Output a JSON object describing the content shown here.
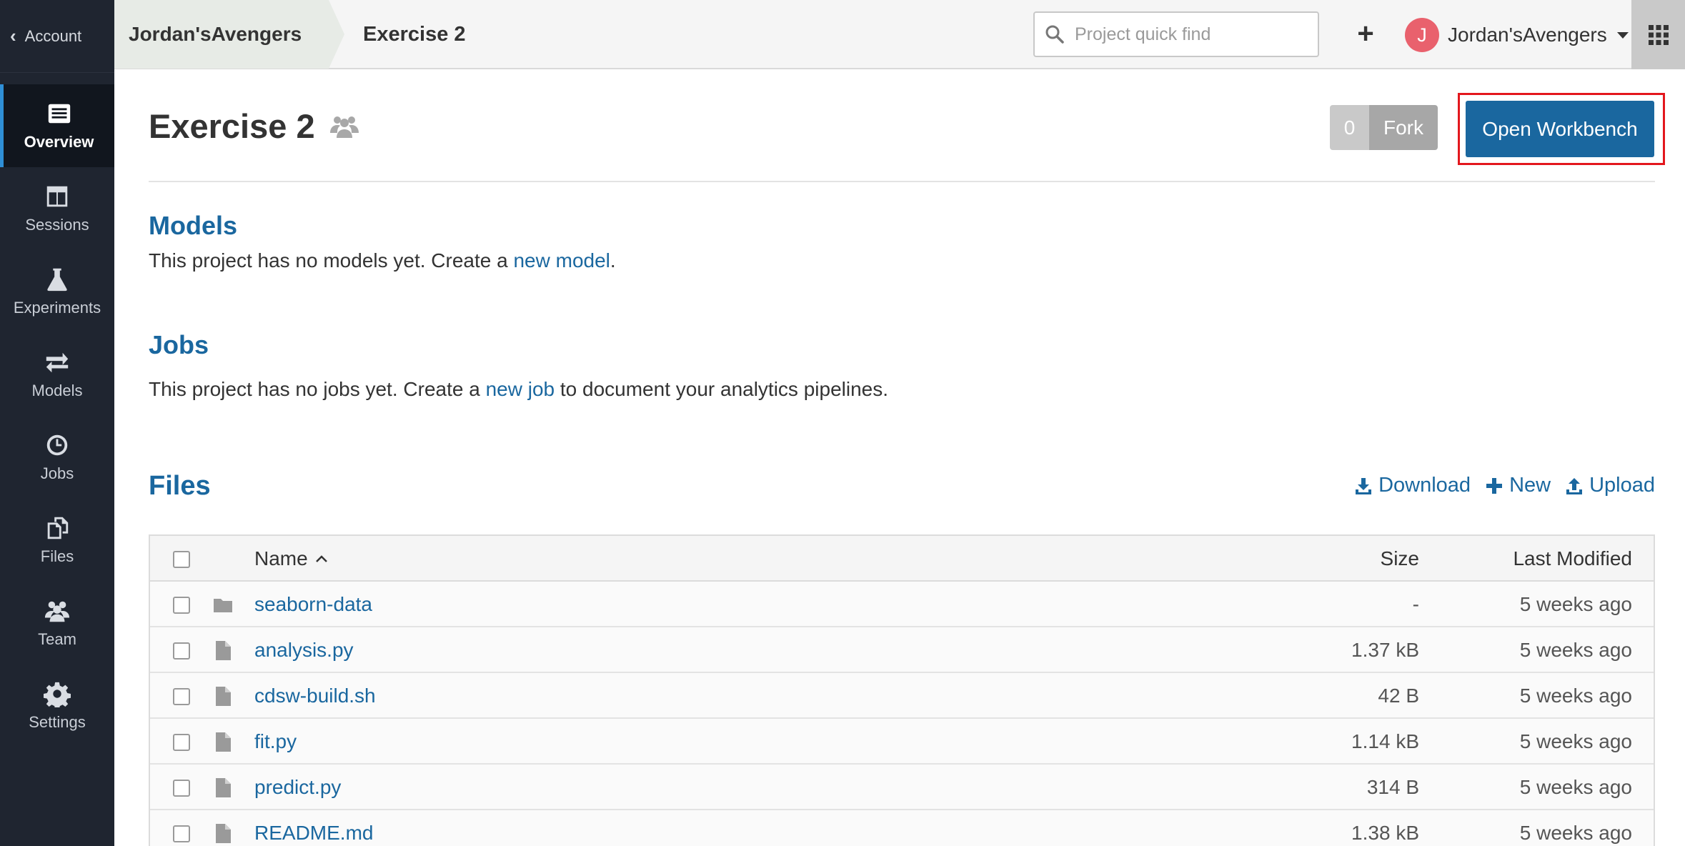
{
  "sidebar": {
    "account_label": "Account",
    "items": [
      {
        "label": "Overview",
        "icon": "overview-icon",
        "active": true
      },
      {
        "label": "Sessions",
        "icon": "sessions-icon",
        "active": false
      },
      {
        "label": "Experiments",
        "icon": "flask-icon",
        "active": false
      },
      {
        "label": "Models",
        "icon": "arrows-icon",
        "active": false
      },
      {
        "label": "Jobs",
        "icon": "clock-icon",
        "active": false
      },
      {
        "label": "Files",
        "icon": "files-icon",
        "active": false
      },
      {
        "label": "Team",
        "icon": "team-icon",
        "active": false
      },
      {
        "label": "Settings",
        "icon": "gear-icon",
        "active": false
      }
    ]
  },
  "topbar": {
    "breadcrumb_team": "Jordan'sAvengers",
    "breadcrumb_project": "Exercise 2",
    "search_placeholder": "Project quick find",
    "user_initial": "J",
    "user_name": "Jordan'sAvengers"
  },
  "project": {
    "title": "Exercise 2",
    "fork_count": "0",
    "fork_label": "Fork",
    "open_workbench_label": "Open Workbench"
  },
  "models": {
    "heading": "Models",
    "text_before": "This project has no models yet. Create a ",
    "link": "new model",
    "text_after": "."
  },
  "jobs": {
    "heading": "Jobs",
    "text_before": "This project has no jobs yet. Create a ",
    "link": "new job",
    "text_after": " to document your analytics pipelines."
  },
  "files": {
    "heading": "Files",
    "actions": {
      "download": "Download",
      "new": "New",
      "upload": "Upload"
    },
    "columns": {
      "name": "Name",
      "size": "Size",
      "modified": "Last Modified"
    },
    "rows": [
      {
        "name": "seaborn-data",
        "type": "folder",
        "size": "-",
        "modified": "5 weeks ago"
      },
      {
        "name": "analysis.py",
        "type": "file",
        "size": "1.37 kB",
        "modified": "5 weeks ago"
      },
      {
        "name": "cdsw-build.sh",
        "type": "file",
        "size": "42 B",
        "modified": "5 weeks ago"
      },
      {
        "name": "fit.py",
        "type": "file",
        "size": "1.14 kB",
        "modified": "5 weeks ago"
      },
      {
        "name": "predict.py",
        "type": "file",
        "size": "314 B",
        "modified": "5 weeks ago"
      },
      {
        "name": "README.md",
        "type": "file",
        "size": "1.38 kB",
        "modified": "5 weeks ago"
      }
    ]
  },
  "colors": {
    "accent": "#1a679f",
    "sidebar_bg": "#1f2530",
    "highlight": "#e3171d"
  }
}
